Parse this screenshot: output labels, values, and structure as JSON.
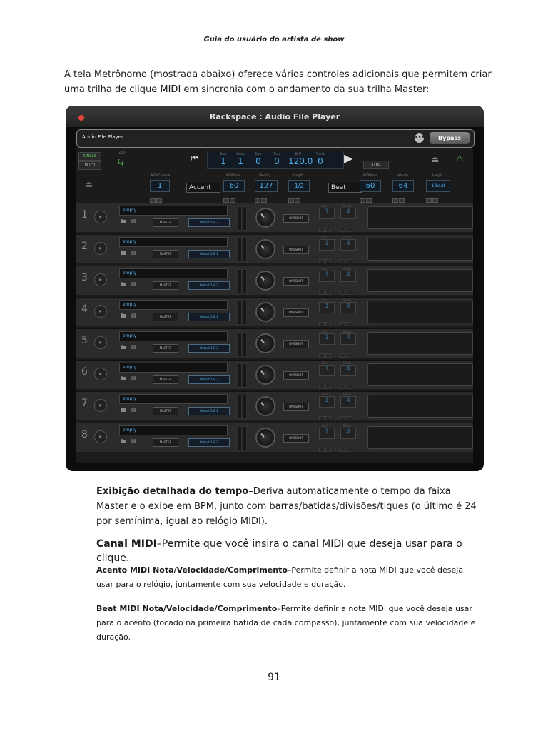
{
  "page": {
    "running_header": "Guia do usuário do artista de show",
    "intro_lines": [
      "A tela Metrônomo (mostrada abaixo) oferece vários controles adicionais que permitem criar",
      "uma trilha de clique MIDI em sincronia com o andamento da sua trilha Master:"
    ],
    "page_number": "91"
  },
  "app": {
    "window_title": "Rackspace : Audio File Player",
    "plugin_name": "Audio File Player",
    "bypass_label": "Bypass",
    "mode_single": "SINGLE",
    "mode_multi": "MULTI",
    "loop_label": "LOOP",
    "sync_label": "SYNC",
    "time_display": [
      {
        "label": "Bars",
        "value": "1"
      },
      {
        "label": "Beats",
        "value": "1"
      },
      {
        "label": "Divs",
        "value": "0"
      },
      {
        "label": "Ticks",
        "value": "0"
      },
      {
        "label": "BPM",
        "value": "120.0"
      },
      {
        "label": "Tracks",
        "value": "0"
      }
    ],
    "midi": {
      "channel_label": "MIDI Channel",
      "channel_value": "1",
      "note_label": "MIDI Note",
      "velocity_label": "Velocity",
      "length_label": "Length",
      "accent": {
        "name": "Accent",
        "note": "60",
        "velocity": "127",
        "length": "1/2"
      },
      "beat": {
        "name": "Beat",
        "note": "60",
        "velocity": "64",
        "length": "1 beat"
      }
    },
    "track_labels": {
      "empty": "empty",
      "master": "MASTER",
      "output": "Output 1 & 2",
      "oneshot": "ONESHOT",
      "bars_label": "Bars",
      "beats_label": "Beats",
      "bars_value": "1",
      "beats_value": "4"
    },
    "tracks": [
      "1",
      "2",
      "3",
      "4",
      "5",
      "6",
      "7",
      "8"
    ]
  },
  "descriptions": {
    "time_display": {
      "term": "Exibição detalhada do tempo",
      "text": "–Deriva automaticamente o tempo da faixa Master e o exibe em BPM, junto com barras/batidas/divisões/tiques (o último é 24 por semínima, igual ao relógio MIDI)."
    },
    "midi_channel": {
      "term": "Canal MIDI",
      "text": "–Permite que você insira o canal MIDI que deseja usar para o clique."
    },
    "accent": {
      "term": "Acento MIDI Nota/Velocidade/Comprimento",
      "text": "–Permite definir a nota MIDI que você deseja usar para o relógio, juntamente com sua velocidade e duração."
    },
    "beat": {
      "term": "Beat MIDI Nota/Velocidade/Comprimento",
      "text": "–Permite definir a nota MIDI que você deseja usar para o acento (tocado na primeira batida de cada compasso), juntamente com sua velocidade e duração."
    }
  }
}
